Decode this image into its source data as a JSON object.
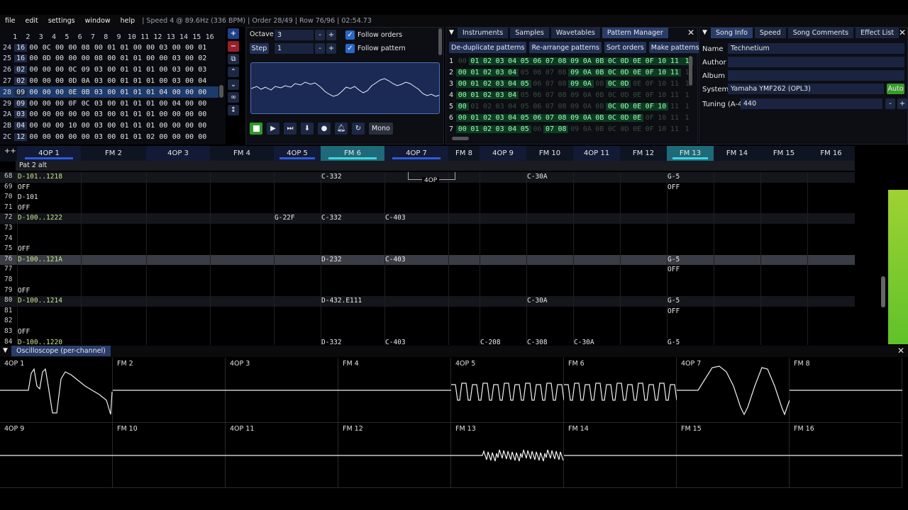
{
  "menu": [
    "file",
    "edit",
    "settings",
    "window",
    "help"
  ],
  "status": "| Speed 4 @ 89.6Hz (336 BPM) | Order 28/49 | Row 76/96 | 02:54.73",
  "orders": {
    "header": [
      "1",
      "2",
      "3",
      "4",
      "5",
      "6",
      "7",
      "8",
      "9",
      "10",
      "11",
      "12",
      "13",
      "14",
      "15",
      "16"
    ],
    "rows": [
      {
        "idx": "24",
        "cells": [
          "16",
          "00",
          "0C",
          "00",
          "00",
          "08",
          "00",
          "01",
          "01",
          "00",
          "00",
          "03",
          "00",
          "00",
          "01"
        ]
      },
      {
        "idx": "25",
        "cells": [
          "16",
          "00",
          "0D",
          "00",
          "00",
          "00",
          "08",
          "00",
          "01",
          "01",
          "00",
          "00",
          "03",
          "00",
          "02"
        ]
      },
      {
        "idx": "26",
        "cells": [
          "02",
          "00",
          "00",
          "00",
          "0C",
          "09",
          "03",
          "00",
          "01",
          "01",
          "01",
          "00",
          "03",
          "00",
          "03"
        ]
      },
      {
        "idx": "27",
        "cells": [
          "02",
          "00",
          "00",
          "00",
          "0D",
          "0A",
          "03",
          "00",
          "01",
          "01",
          "01",
          "00",
          "03",
          "00",
          "04"
        ]
      },
      {
        "idx": "28",
        "cells": [
          "09",
          "00",
          "00",
          "00",
          "0E",
          "0B",
          "03",
          "00",
          "01",
          "01",
          "01",
          "04",
          "00",
          "00",
          "00"
        ]
      },
      {
        "idx": "29",
        "cells": [
          "09",
          "00",
          "00",
          "00",
          "0F",
          "0C",
          "03",
          "00",
          "01",
          "01",
          "01",
          "00",
          "04",
          "00",
          "00"
        ]
      },
      {
        "idx": "2A",
        "cells": [
          "03",
          "00",
          "00",
          "00",
          "00",
          "00",
          "03",
          "00",
          "01",
          "01",
          "01",
          "00",
          "00",
          "00",
          "00"
        ]
      },
      {
        "idx": "2B",
        "cells": [
          "04",
          "00",
          "00",
          "00",
          "10",
          "00",
          "03",
          "00",
          "01",
          "01",
          "01",
          "00",
          "00",
          "00",
          "00"
        ]
      },
      {
        "idx": "2C",
        "cells": [
          "12",
          "00",
          "00",
          "00",
          "00",
          "00",
          "03",
          "00",
          "01",
          "01",
          "02",
          "00",
          "00",
          "00",
          "00"
        ]
      }
    ]
  },
  "controls": {
    "octave_label": "Octave",
    "octave_value": "3",
    "step_label": "Step",
    "step_value": "1",
    "follow_orders": "Follow orders",
    "follow_pattern": "Follow pattern",
    "mono": "Mono"
  },
  "pattern_manager": {
    "tabs": [
      "Instruments",
      "Samples",
      "Wavetables",
      "Pattern Manager"
    ],
    "buttons": [
      "De-duplicate patterns",
      "Re-arrange patterns",
      "Sort orders",
      "Make patterns unique"
    ],
    "rows": [
      {
        "ch": "1",
        "cells": [
          "00",
          "01",
          "02",
          "03",
          "04",
          "05",
          "06",
          "07",
          "08",
          "09",
          "0A",
          "0B",
          "0C",
          "0D",
          "0E",
          "0F",
          "10",
          "11",
          "1"
        ],
        "on": [
          0,
          1,
          1,
          1,
          1,
          1,
          1,
          1,
          1,
          1,
          1,
          1,
          1,
          1,
          1,
          1,
          1,
          1,
          1
        ]
      },
      {
        "ch": "2",
        "cells": [
          "00",
          "01",
          "02",
          "03",
          "04",
          "05",
          "06",
          "07",
          "08",
          "09",
          "0A",
          "0B",
          "0C",
          "0D",
          "0E",
          "0F",
          "10",
          "11",
          "1"
        ],
        "on": [
          1,
          1,
          1,
          1,
          1,
          0,
          0,
          0,
          0,
          1,
          1,
          1,
          1,
          1,
          1,
          1,
          1,
          1,
          0
        ]
      },
      {
        "ch": "3",
        "cells": [
          "00",
          "01",
          "02",
          "03",
          "04",
          "05",
          "06",
          "07",
          "08",
          "09",
          "0A",
          "0B",
          "0C",
          "0D",
          "0E",
          "0F",
          "10",
          "11",
          "1"
        ],
        "on": [
          1,
          1,
          1,
          1,
          1,
          1,
          0,
          0,
          0,
          1,
          1,
          0,
          1,
          1,
          0,
          0,
          0,
          0,
          0
        ]
      },
      {
        "ch": "4",
        "cells": [
          "00",
          "01",
          "02",
          "03",
          "04",
          "05",
          "06",
          "07",
          "08",
          "09",
          "0A",
          "0B",
          "0C",
          "0D",
          "0E",
          "0F",
          "10",
          "11",
          "1"
        ],
        "on": [
          1,
          1,
          1,
          1,
          1,
          0,
          0,
          0,
          0,
          0,
          0,
          0,
          0,
          0,
          0,
          0,
          0,
          0,
          0
        ]
      },
      {
        "ch": "5",
        "cells": [
          "00",
          "01",
          "02",
          "03",
          "04",
          "05",
          "06",
          "07",
          "08",
          "09",
          "0A",
          "0B",
          "0C",
          "0D",
          "0E",
          "0F",
          "10",
          "11",
          "1"
        ],
        "on": [
          1,
          0,
          0,
          0,
          0,
          0,
          0,
          0,
          0,
          0,
          0,
          0,
          1,
          1,
          1,
          1,
          1,
          0,
          0
        ]
      },
      {
        "ch": "6",
        "cells": [
          "00",
          "01",
          "02",
          "03",
          "04",
          "05",
          "06",
          "07",
          "08",
          "09",
          "0A",
          "0B",
          "0C",
          "0D",
          "0E",
          "0F",
          "10",
          "11",
          "1"
        ],
        "on": [
          1,
          1,
          1,
          1,
          1,
          1,
          1,
          1,
          1,
          1,
          1,
          1,
          1,
          1,
          1,
          0,
          0,
          0,
          0
        ]
      },
      {
        "ch": "7",
        "cells": [
          "00",
          "01",
          "02",
          "03",
          "04",
          "05",
          "06",
          "07",
          "08",
          "09",
          "0A",
          "0B",
          "0C",
          "0D",
          "0E",
          "0F",
          "10",
          "11",
          "1"
        ],
        "on": [
          1,
          1,
          1,
          1,
          1,
          1,
          0,
          1,
          1,
          0,
          0,
          0,
          0,
          0,
          0,
          0,
          0,
          0,
          0
        ]
      }
    ]
  },
  "song_info": {
    "tabs": [
      "Song Info",
      "Speed",
      "Song Comments",
      "Effect List"
    ],
    "name_label": "Name",
    "name": "Technetium",
    "author_label": "Author",
    "author": "",
    "album_label": "Album",
    "album": "",
    "system_label": "System",
    "system": "Yamaha YMF262 (OPL3)",
    "auto": "Auto",
    "tuning_label": "Tuning (A-4)",
    "tuning": "440"
  },
  "channels": [
    "4OP 1",
    "FM 2",
    "4OP 3",
    "FM 4",
    "4OP 5",
    "FM 6",
    "4OP 7",
    "FM 8",
    "4OP 9",
    "FM 10",
    "4OP 11",
    "FM 12",
    "FM 13",
    "FM 14",
    "FM 15",
    "FM 16"
  ],
  "pattern_name": "Pat 2 alt",
  "marker": "4OP",
  "tracker_rows": [
    {
      "n": "68",
      "hl": true,
      "c1": "D-101..1218",
      "c6": "C-332",
      "c10": "C-30A",
      "c12": "G-5"
    },
    {
      "n": "69",
      "c1": "OFF",
      "c12": "OFF"
    },
    {
      "n": "70",
      "c1": "D-101"
    },
    {
      "n": "71",
      "c1": "OFF"
    },
    {
      "n": "72",
      "hl": true,
      "c1": "D-100..1222",
      "c5": "G-22F",
      "c6": "C-332",
      "c7": "C-403"
    },
    {
      "n": "73"
    },
    {
      "n": "74"
    },
    {
      "n": "75",
      "c1": "OFF"
    },
    {
      "n": "76",
      "cur": true,
      "c1": "D-100..121A",
      "c6": "D-232",
      "c7": "C-403",
      "c12": "G-5"
    },
    {
      "n": "77",
      "c12": "OFF"
    },
    {
      "n": "78"
    },
    {
      "n": "79",
      "c1": "OFF"
    },
    {
      "n": "80",
      "hl": true,
      "c1": "D-100..1214",
      "c6": "D-432.E111",
      "c10": "C-30A",
      "c12": "G-5"
    },
    {
      "n": "81",
      "c12": "OFF"
    },
    {
      "n": "82"
    },
    {
      "n": "83",
      "c1": "OFF"
    },
    {
      "n": "84",
      "c1": "D-100..1220",
      "c6": "D-332",
      "c7": "C-403",
      "c9": "C-208",
      "c10": "C-308",
      "c11": "C-30A",
      "c12": "G-5"
    }
  ],
  "oscilloscope": {
    "title": "Oscilloscope (per-channel)",
    "labels": [
      "4OP 1",
      "FM 2",
      "4OP 3",
      "FM 4",
      "4OP 5",
      "FM 6",
      "4OP 7",
      "FM 8",
      "4OP 9",
      "FM 10",
      "4OP 11",
      "FM 12",
      "FM 13",
      "FM 14",
      "FM 15",
      "FM 16"
    ]
  },
  "colors": {
    "accent": "#2a68c8",
    "cyan": "#3fd4e6",
    "green": "#7cdc3a",
    "note": "#e8e8e8"
  }
}
